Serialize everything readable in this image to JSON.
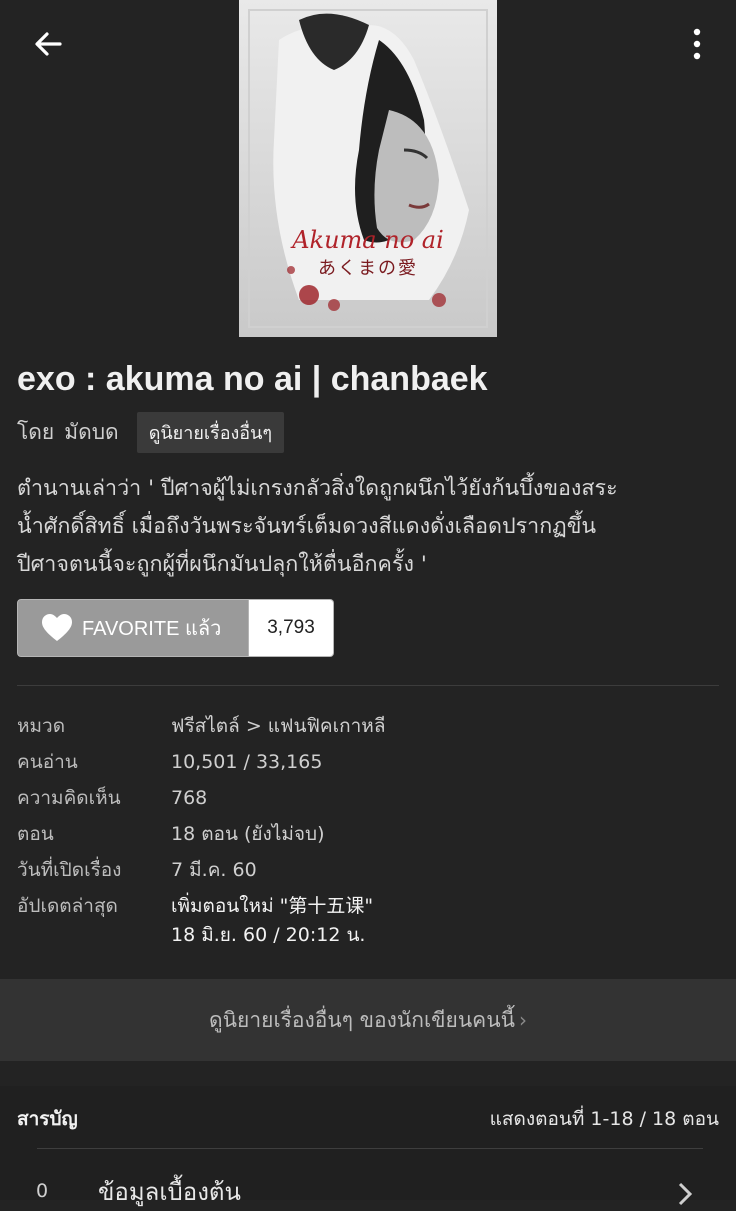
{
  "cover": {
    "title": "Akuma no ai",
    "subtitle": "あくまの愛"
  },
  "story": {
    "title": "exo : akuma no ai | chanbaek",
    "by_label": "โดย",
    "author": "มัดบด",
    "more_by_author": "ดูนิยายเรื่องอื่นๆ",
    "synopsis": [
      "ตำนานเล่าว่า ' ปีศาจผู้ไม่เกรงกลัวสิ่งใดถูกผนึกไว้ยังก้นบึ้งของสระ",
      "น้ำศักดิ์สิทธิ์ เมื่อถึงวันพระจันทร์เต็มดวงสีแดงดั่งเลือดปรากฏขึ้น",
      "ปีศาจตนนี้จะถูกผู้ที่ผนึกมันปลุกให้ตื่นอีกครั้ง '"
    ]
  },
  "favorite": {
    "label": "FAVORITE แล้ว",
    "count": "3,793"
  },
  "info": {
    "category_label": "หมวด",
    "category": "ฟรีสไตล์ > แฟนฟิคเกาหลี",
    "readers_label": "คนอ่าน",
    "readers": "10,501 / 33,165",
    "comments_label": "ความคิดเห็น",
    "comments": "768",
    "chapters_label": "ตอน",
    "chapters": "18 ตอน (ยังไม่จบ)",
    "opened_label": "วันที่เปิดเรื่อง",
    "opened": "7 มี.ค. 60",
    "updated_label": "อัปเดตล่าสุด",
    "updated_line1": "เพิ่มตอนใหม่ \"第十五课\"",
    "updated_line2": "18 มิ.ย. 60 / 20:12 น."
  },
  "more_works": {
    "label": "ดูนิยายเรื่องอื่นๆ ของนักเขียนคนนี้",
    "chevron": "›"
  },
  "toc": {
    "title": "สารบัญ",
    "count": "แสดงตอนที่ 1-18 / 18 ตอน",
    "items": [
      {
        "num": "0",
        "name": "ข้อมูลเบื้องต้น"
      }
    ]
  },
  "colors": {
    "background": "#232323",
    "favorite": "#9a9a9a",
    "banner": "#333333"
  },
  "icons": [
    "back-arrow-icon",
    "more-vert-icon",
    "heart-icon",
    "chevron-right-icon"
  ]
}
